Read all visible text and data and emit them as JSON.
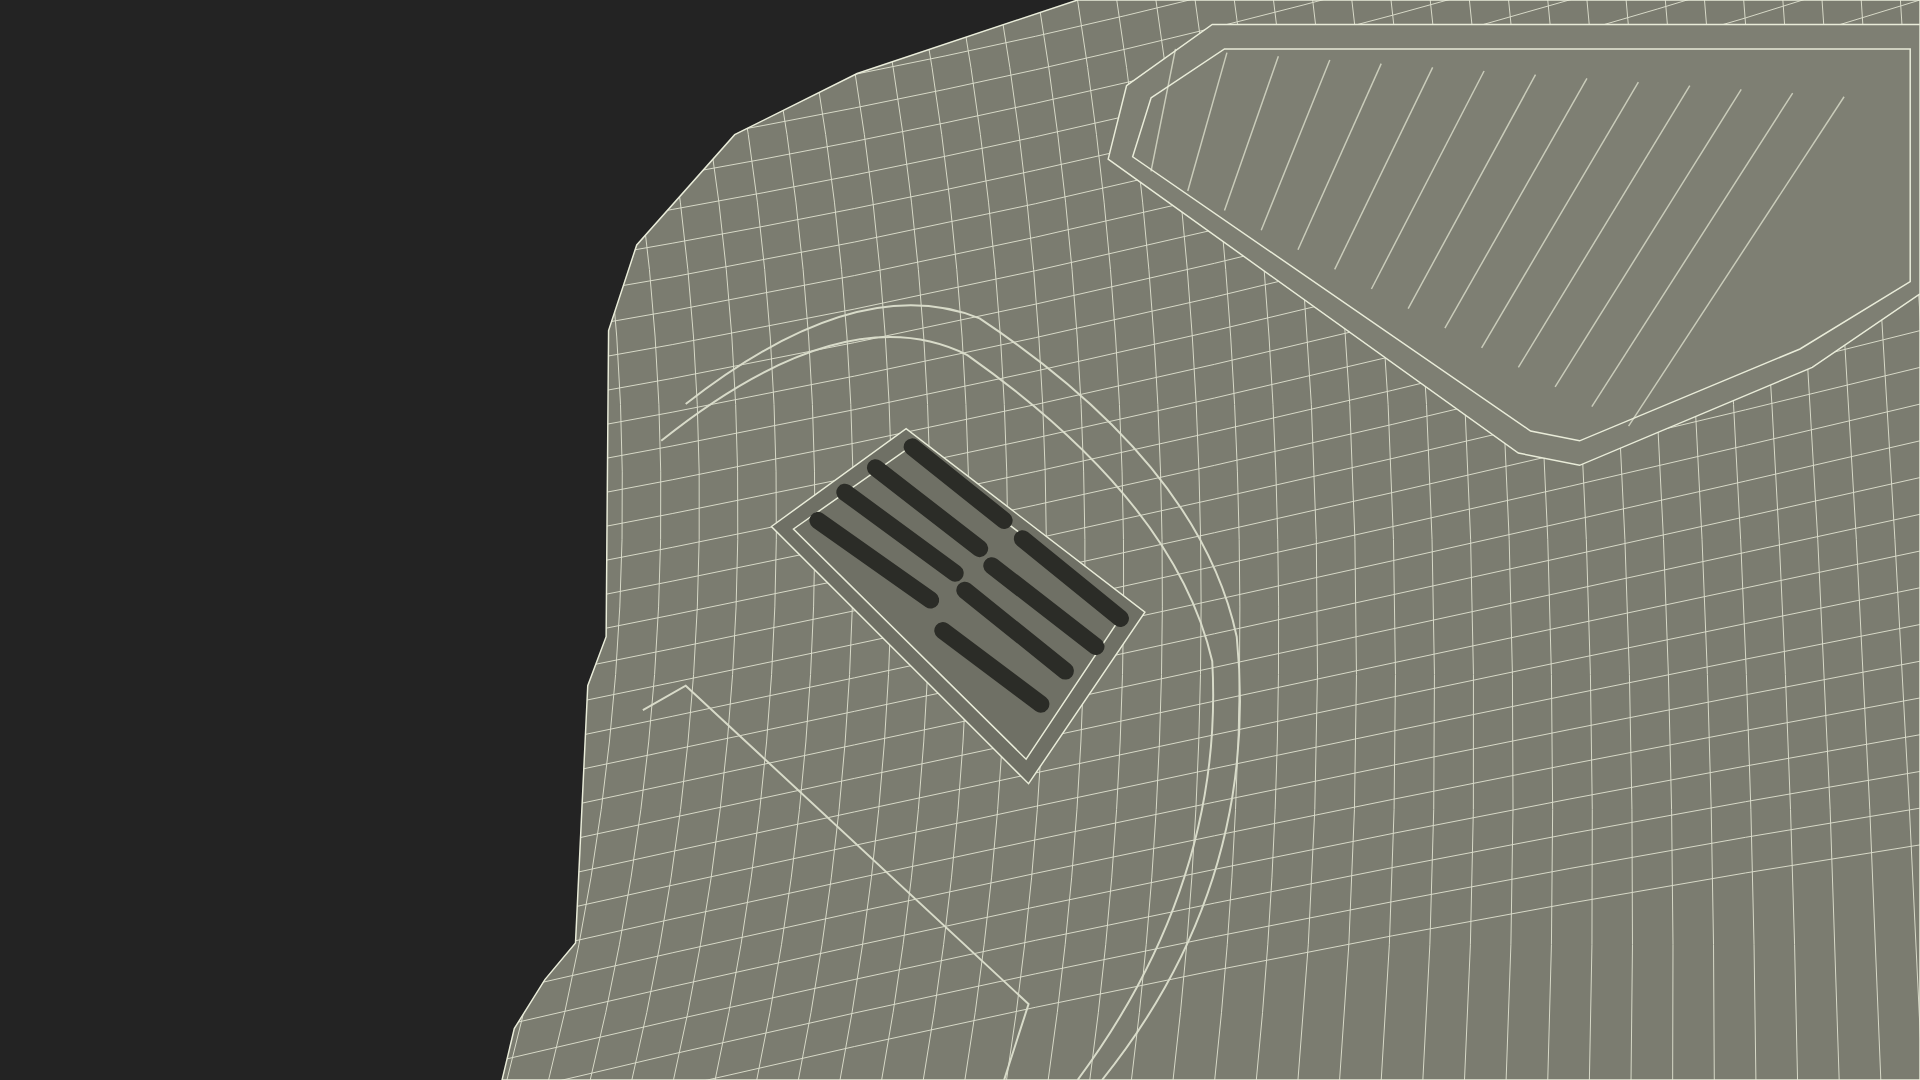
{
  "render": {
    "kind": "wireframe"
  }
}
